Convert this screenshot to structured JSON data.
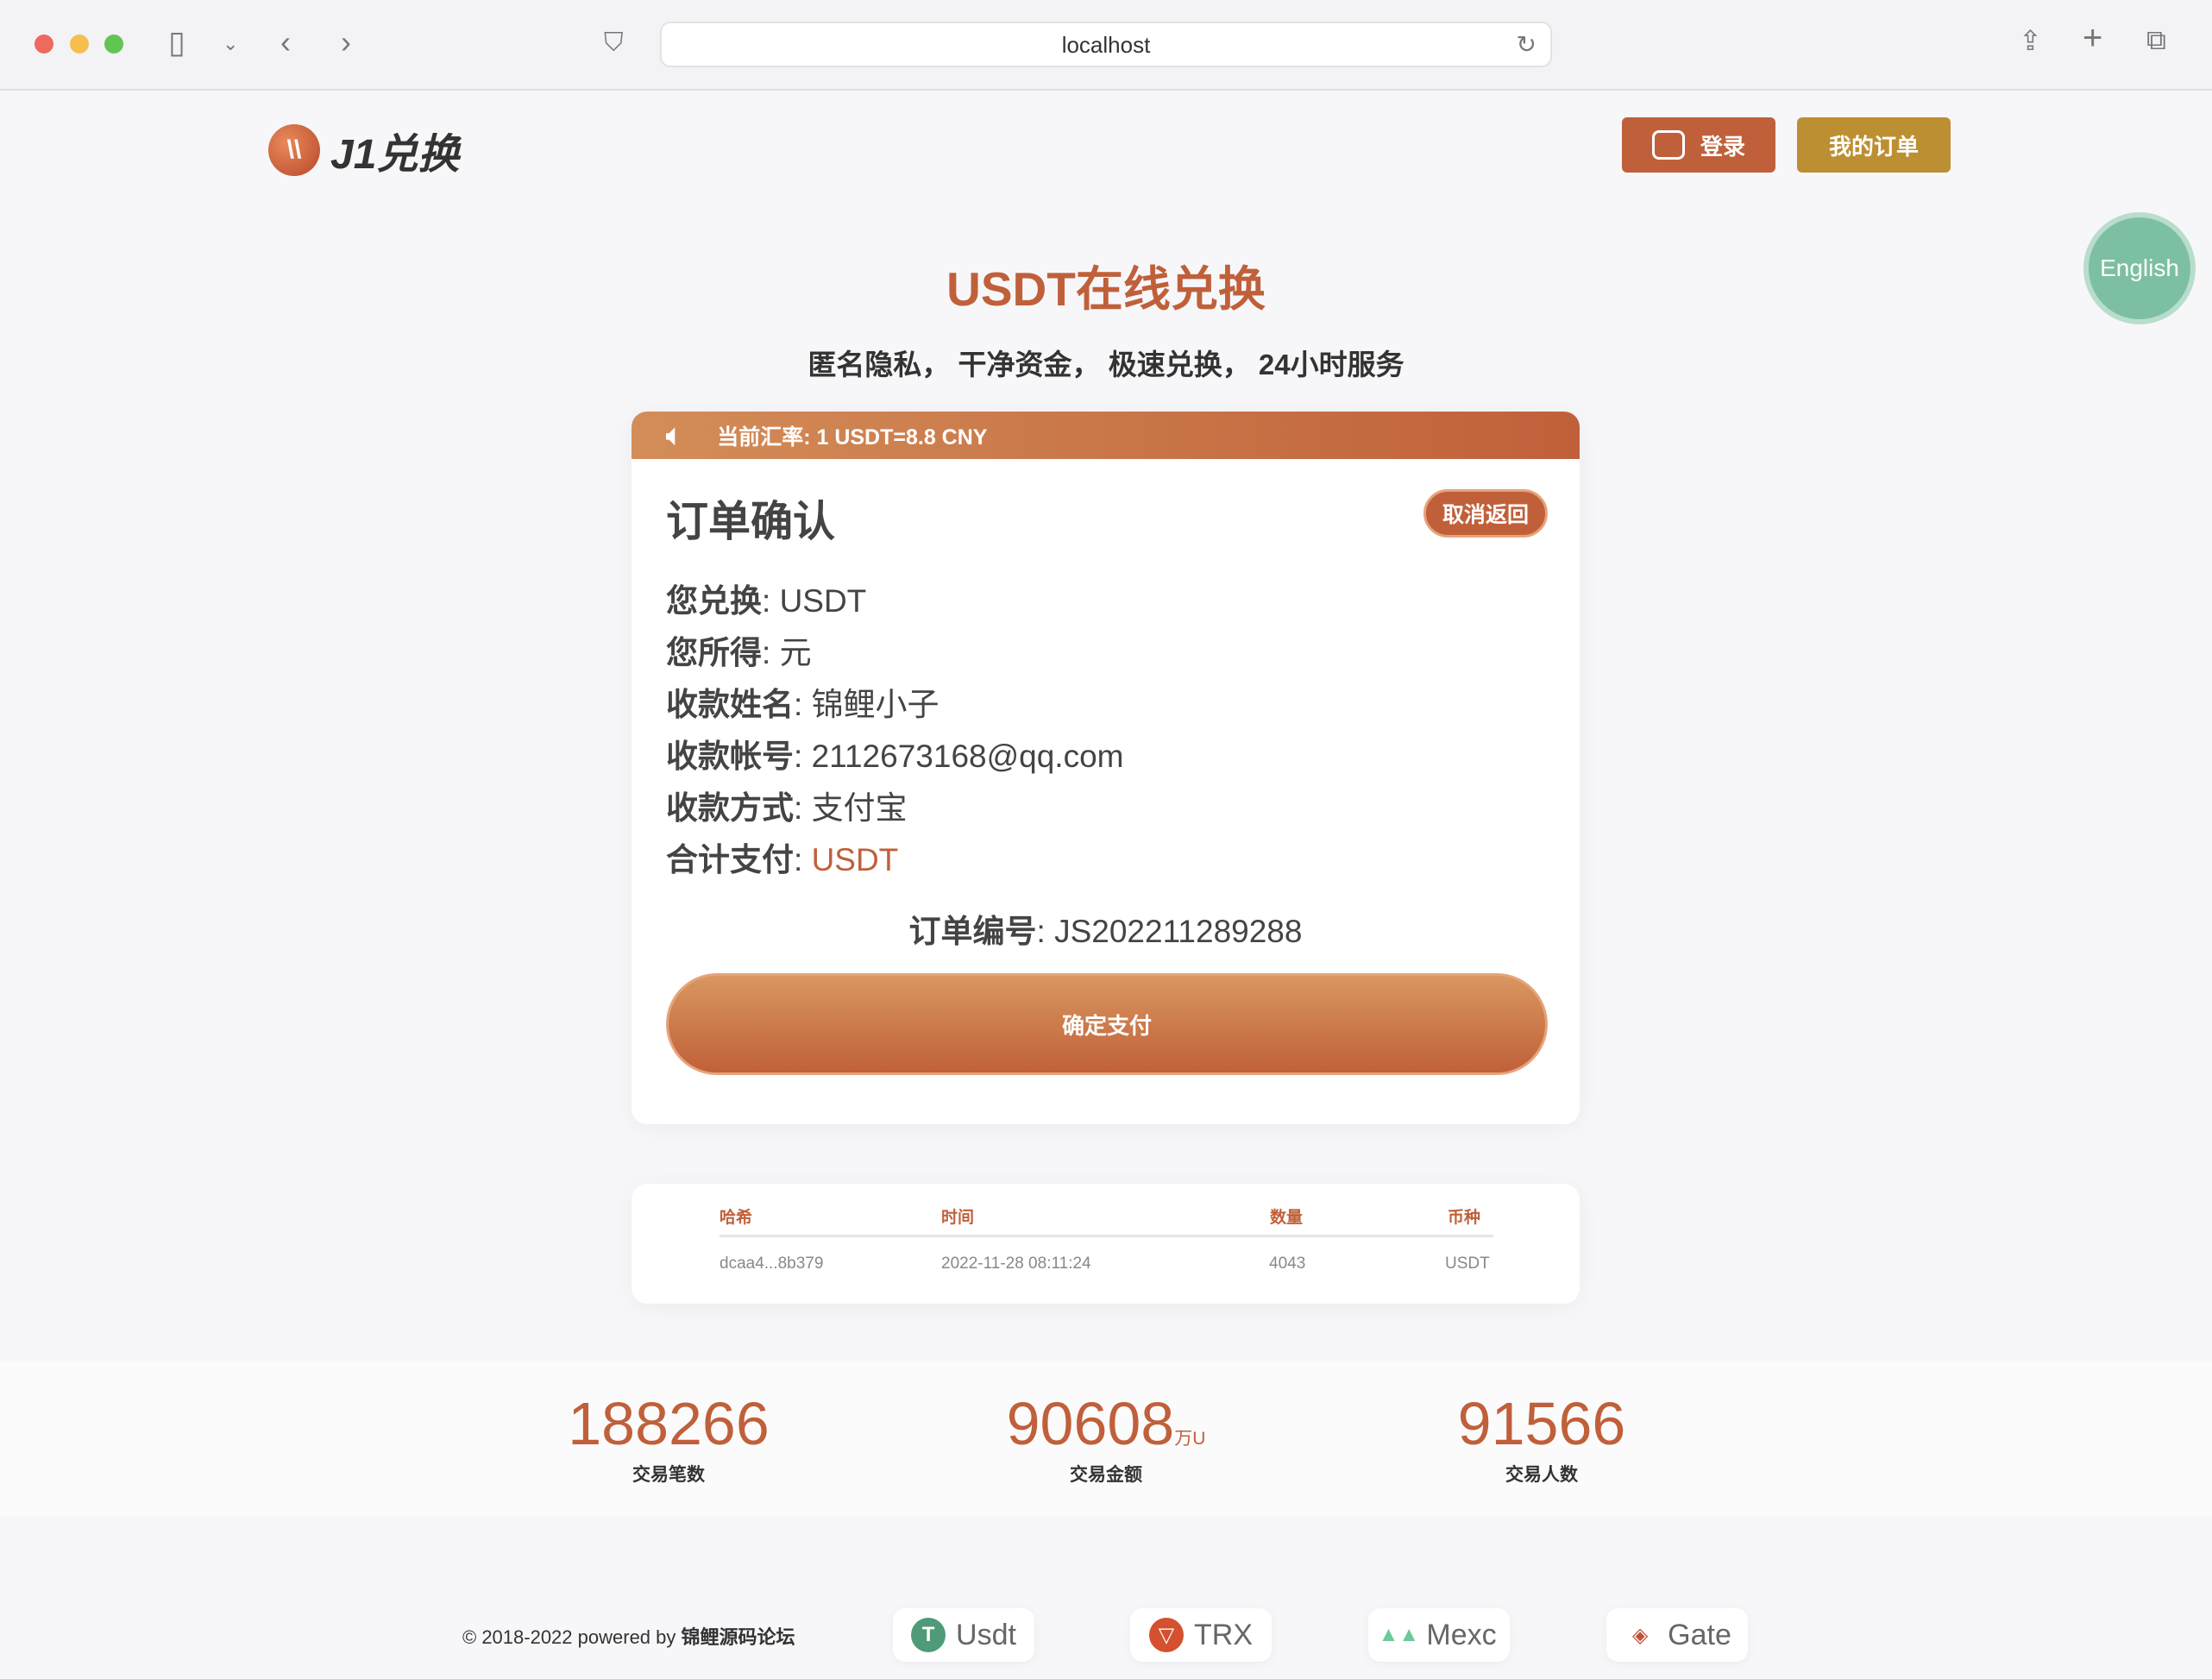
{
  "browser": {
    "url": "localhost"
  },
  "header": {
    "logo_text": "J1兑换",
    "login_label": "登录",
    "orders_label": "我的订单",
    "language_label": "English"
  },
  "hero": {
    "title": "USDT在线兑换",
    "subtitle": "匿名隐私， 干净资金， 极速兑换， 24小时服务"
  },
  "rate": {
    "text": "当前汇率: 1 USDT=8.8 CNY"
  },
  "order": {
    "title": "订单确认",
    "cancel_label": "取消返回",
    "fields": [
      {
        "label": "您兑换",
        "value": "USDT"
      },
      {
        "label": "您所得",
        "value": "元"
      },
      {
        "label": "收款姓名",
        "value": "锦鲤小子"
      },
      {
        "label": "收款帐号",
        "value": "2112673168@qq.com"
      },
      {
        "label": "收款方式",
        "value": "支付宝"
      },
      {
        "label": "合计支付",
        "value": "USDT"
      }
    ],
    "order_no_label": "订单编号",
    "order_no": "JS202211289288",
    "confirm_label": "确定支付"
  },
  "table": {
    "headers": [
      "哈希",
      "时间",
      "数量",
      "币种"
    ],
    "rows": [
      [
        "dcaa4...8b379",
        "2022-11-28 08:11:24",
        "4043",
        "USDT"
      ]
    ]
  },
  "stats": [
    {
      "value": "188266",
      "unit": "",
      "label": "交易笔数"
    },
    {
      "value": "90608",
      "unit": "万U",
      "label": "交易金额"
    },
    {
      "value": "91566",
      "unit": "",
      "label": "交易人数"
    }
  ],
  "footer": {
    "copyright": "© 2018-2022 powered by",
    "brand": "锦鲤源码论坛",
    "badges": [
      "Usdt",
      "TRX",
      "Mexc",
      "Gate"
    ]
  },
  "colors": {
    "accent": "#c0603a",
    "gold": "#bd8f33",
    "english": "#7dbfa3"
  }
}
